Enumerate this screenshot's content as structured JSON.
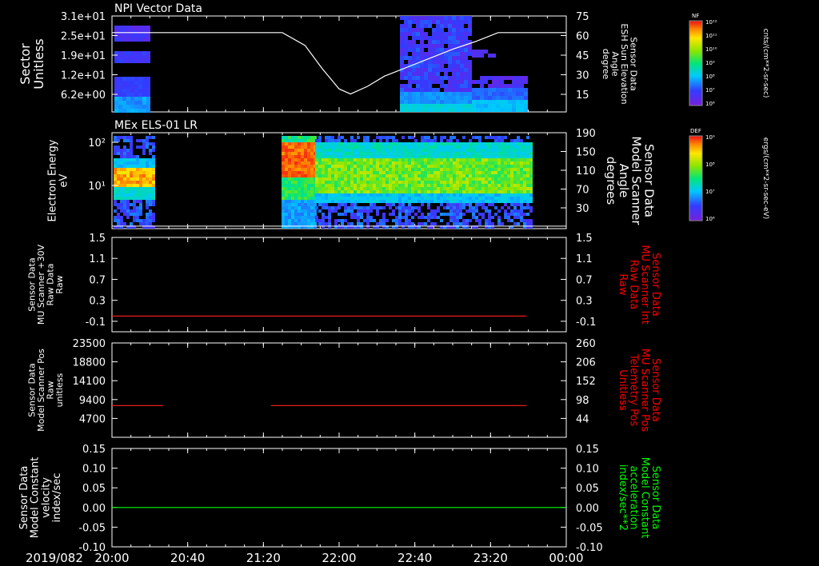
{
  "figure": {
    "date_label": "2019/082",
    "time_ticks": [
      "20:00",
      "20:40",
      "21:20",
      "22:00",
      "22:40",
      "23:20",
      "00:00"
    ],
    "time_range_hours": [
      20,
      24
    ],
    "time_tick_hours": [
      20,
      20.6667,
      21.3333,
      22,
      22.6667,
      23.3333,
      24
    ]
  },
  "chart_data": [
    {
      "type": "heatmap",
      "title": "NPI Vector Data",
      "ylabel_lines": [
        "Sector",
        "Unitless"
      ],
      "yticks": [
        "3.1e+01",
        "2.5e+01",
        "1.9e+01",
        "1.2e+01",
        "6.2e+00"
      ],
      "y2label_lines": [
        "Sensor Data",
        "ESH Sun Elevation",
        "Angle",
        "degree"
      ],
      "y2ticks": [
        "75",
        "60",
        "45",
        "30",
        "15"
      ],
      "y2lim": [
        0,
        75
      ],
      "line_series": {
        "color": "#ffffff",
        "x_hours": [
          20.0,
          20.5,
          21.0,
          21.5,
          21.7,
          21.85,
          22.0,
          22.1,
          22.25,
          22.4,
          22.6,
          22.8,
          23.0,
          23.2,
          23.4,
          24.0
        ],
        "y": [
          62,
          62,
          62,
          62,
          52,
          34,
          18,
          14,
          20,
          28,
          35,
          42,
          49,
          55,
          62,
          62
        ]
      },
      "colorbar": {
        "label": "NF",
        "unit": "cnts/(cm**2-sr-sec)",
        "ticks": [
          "10¹²",
          "10¹¹",
          "10¹⁰",
          "10⁹",
          "10⁸",
          "10⁷",
          "10⁶"
        ]
      }
    },
    {
      "type": "heatmap",
      "title": "MEx ELS-01 LR",
      "ylabel_lines": [
        "Electron Energy",
        "eV"
      ],
      "yticks": [
        "10²",
        "10¹"
      ],
      "y2label_lines": [
        "Sensor Data",
        "Model Scanner",
        "Angle",
        "degrees"
      ],
      "y2ticks": [
        "190",
        "150",
        "110",
        "70",
        "30"
      ],
      "y2lim": [
        0,
        190
      ],
      "line_series": {
        "color": "#ffffff",
        "x_hours": [
          20.0,
          24.0
        ],
        "y": [
          5,
          5
        ]
      },
      "colorbar": {
        "label": "DEF",
        "unit": "ergs/(cm**2-sr-sec-eV)",
        "ticks": [
          "10⁹",
          "10⁸",
          "10⁷",
          "10⁶"
        ]
      }
    },
    {
      "type": "line",
      "ylabel_lines": [
        "Sensor Data",
        "MU Scanner +30V",
        "Raw Data",
        "Raw"
      ],
      "ylabel_color": "#ffffff",
      "yticks": [
        "1.5",
        "1.1",
        "0.7",
        "0.3",
        "-0.1"
      ],
      "ylim": [
        -0.3,
        1.5
      ],
      "y2label_lines": [
        "Sensor Data",
        "MU Scanner Int",
        "Raw Data",
        "Raw"
      ],
      "y2label_color": "#ff0000",
      "y2ticks": [
        "1.5",
        "1.1",
        "0.7",
        "0.3",
        "-0.1"
      ],
      "series": [
        {
          "color": "#ff2020",
          "segments": [
            {
              "x_hours": [
                20.0,
                23.65
              ],
              "y": [
                0.0,
                0.0
              ]
            }
          ]
        }
      ]
    },
    {
      "type": "line",
      "ylabel_lines": [
        "Sensor Data",
        "Model Scanner Pos",
        "Raw",
        "unitless"
      ],
      "ylabel_color": "#ffffff",
      "yticks": [
        "23500",
        "18800",
        "14100",
        "9400",
        "4700"
      ],
      "ylim": [
        0,
        23500
      ],
      "y2label_lines": [
        "Sensor Data",
        "MU Scanner Pos",
        "Telemetry Pos",
        "Unitless"
      ],
      "y2label_color": "#ff0000",
      "y2ticks": [
        "260",
        "206",
        "152",
        "98",
        "44"
      ],
      "series": [
        {
          "color": "#ff2020",
          "segments": [
            {
              "x_hours": [
                20.0,
                20.45
              ],
              "y": [
                7900,
                7900
              ]
            },
            {
              "x_hours": [
                21.4,
                23.65
              ],
              "y": [
                7900,
                7900
              ]
            }
          ]
        }
      ]
    },
    {
      "type": "line",
      "ylabel_lines": [
        "Sensor Data",
        "Model Constant",
        "velocity",
        "index/sec"
      ],
      "ylabel_color": "#ffffff",
      "yticks": [
        "0.15",
        "0.10",
        "0.05",
        "0.00",
        "-0.05",
        "-0.10"
      ],
      "ylim": [
        -0.1,
        0.15
      ],
      "y2label_lines": [
        "Sensor Data",
        "Model Constant",
        "acceleration",
        "index/sec**2"
      ],
      "y2label_color": "#00ff00",
      "y2ticks": [
        "0.15",
        "0.10",
        "0.05",
        "0.00",
        "-0.05",
        "-0.10"
      ],
      "series": [
        {
          "color": "#00ff00",
          "segments": [
            {
              "x_hours": [
                20.0,
                24.0
              ],
              "y": [
                0.0,
                0.0
              ]
            }
          ]
        }
      ]
    }
  ]
}
